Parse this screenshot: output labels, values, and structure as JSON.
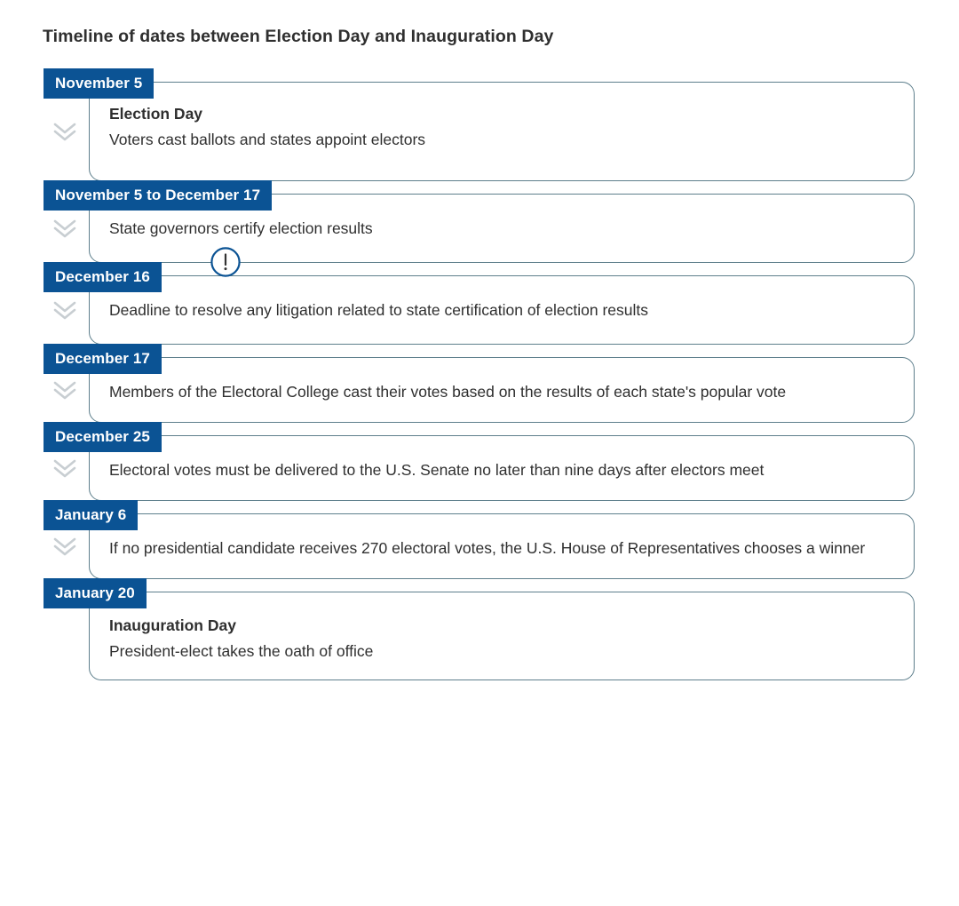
{
  "page": {
    "title": "Timeline of dates between Election Day and Inauguration Day",
    "background_color": "#ffffff",
    "accent_color": "#0b5394",
    "card_border_color": "#5e7f8c",
    "text_color": "#2f2f2f",
    "connector_color": "#c8ced2"
  },
  "timeline": {
    "connector_icon": "double-chevron-down-icon",
    "alert_icon": "exclamation-circle-icon",
    "items": [
      {
        "date": "November 5",
        "heading": "Election Day",
        "description": "Voters cast ballots and states appoint electors",
        "has_alert": false,
        "has_connector": true
      },
      {
        "date": "November 5 to December 17",
        "heading": "",
        "description": "State governors certify election results",
        "has_alert": false,
        "has_connector": true
      },
      {
        "date": "December 16",
        "heading": "",
        "description": "Deadline to resolve any litigation related to state certification of election results",
        "has_alert": true,
        "has_connector": true
      },
      {
        "date": "December 17",
        "heading": "",
        "description": "Members of the Electoral College cast their votes based on the results of each state's popular vote",
        "has_alert": false,
        "has_connector": true
      },
      {
        "date": "December 25",
        "heading": "",
        "description": "Electoral votes must be delivered to the U.S. Senate no later than nine days after electors meet",
        "has_alert": false,
        "has_connector": true
      },
      {
        "date": "January 6",
        "heading": "",
        "description": "If no presidential candidate receives 270 electoral votes, the U.S. House of Representatives chooses a winner",
        "has_alert": false,
        "has_connector": true
      },
      {
        "date": "January 20",
        "heading": "Inauguration Day",
        "description": "President-elect takes the oath of office",
        "has_alert": false,
        "has_connector": false
      }
    ]
  }
}
